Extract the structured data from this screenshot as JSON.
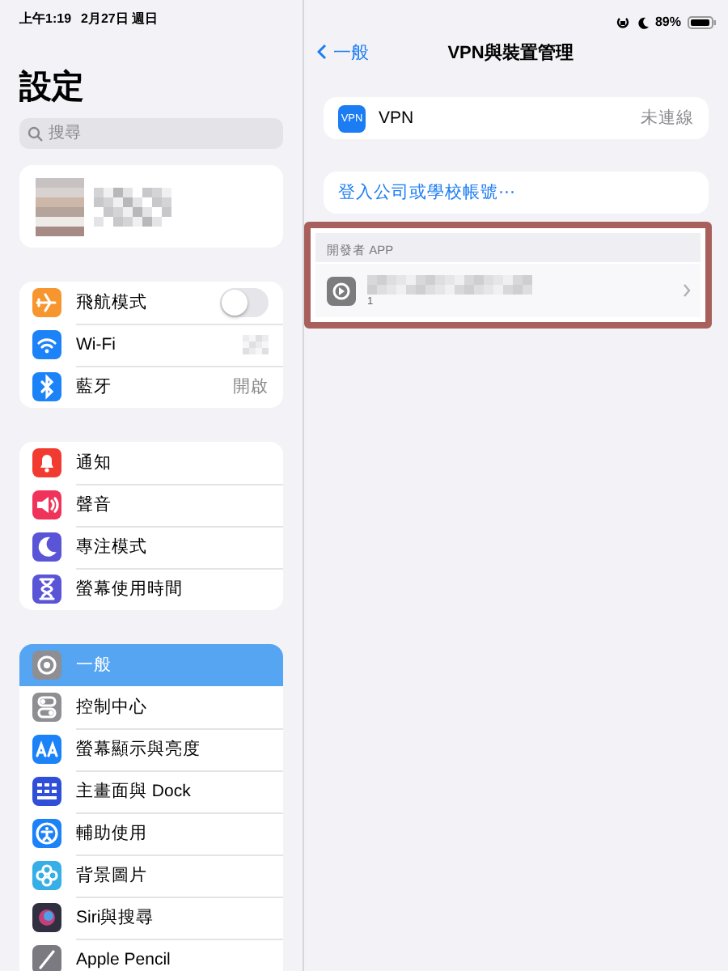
{
  "status_bar": {
    "time": "上午1:19",
    "date": "2月27日 週日",
    "battery": "89%"
  },
  "sidebar": {
    "title": "設定",
    "search": {
      "placeholder": "搜尋"
    },
    "groups": [
      {
        "items": [
          {
            "label": "飛航模式",
            "kind": "toggle",
            "on": false,
            "selected": false,
            "color": "#f7962e"
          },
          {
            "label": "Wi-Fi",
            "kind": "hidden-value",
            "selected": false,
            "color": "#1b82f7"
          },
          {
            "label": "藍牙",
            "kind": "value",
            "value": "開啟",
            "selected": false,
            "color": "#1b82f7"
          }
        ]
      },
      {
        "items": [
          {
            "label": "通知",
            "kind": "plain",
            "selected": false,
            "color": "#f23b30"
          },
          {
            "label": "聲音",
            "kind": "plain",
            "selected": false,
            "color": "#f0335a"
          },
          {
            "label": "專注模式",
            "kind": "plain",
            "selected": false,
            "color": "#5a55d6"
          },
          {
            "label": "螢幕使用時間",
            "kind": "plain",
            "selected": false,
            "color": "#5a55d6"
          }
        ]
      },
      {
        "items": [
          {
            "label": "一般",
            "kind": "plain",
            "selected": true,
            "color": "#8e8e93"
          },
          {
            "label": "控制中心",
            "kind": "plain",
            "selected": false,
            "color": "#8e8e93"
          },
          {
            "label": "螢幕顯示與亮度",
            "kind": "plain",
            "selected": false,
            "color": "#1b82f7"
          },
          {
            "label": "主畫面與 Dock",
            "kind": "plain",
            "selected": false,
            "color": "#2f4fd8"
          },
          {
            "label": "輔助使用",
            "kind": "plain",
            "selected": false,
            "color": "#1b82f7"
          },
          {
            "label": "背景圖片",
            "kind": "plain",
            "selected": false,
            "color": "#36aee6"
          },
          {
            "label": "Siri與搜尋",
            "kind": "plain",
            "selected": false,
            "color": "#303040"
          },
          {
            "label": "Apple Pencil",
            "kind": "plain",
            "selected": false,
            "color": "#7a7a80"
          }
        ]
      }
    ]
  },
  "detail": {
    "back": "一般",
    "title": "VPN與裝置管理",
    "vpn": {
      "icon_text": "VPN",
      "label": "VPN",
      "value": "未連線"
    },
    "sign_in": "登入公司或學校帳號⋯",
    "developer": {
      "header": "開發者 APP",
      "app_subtitle": "1"
    }
  }
}
